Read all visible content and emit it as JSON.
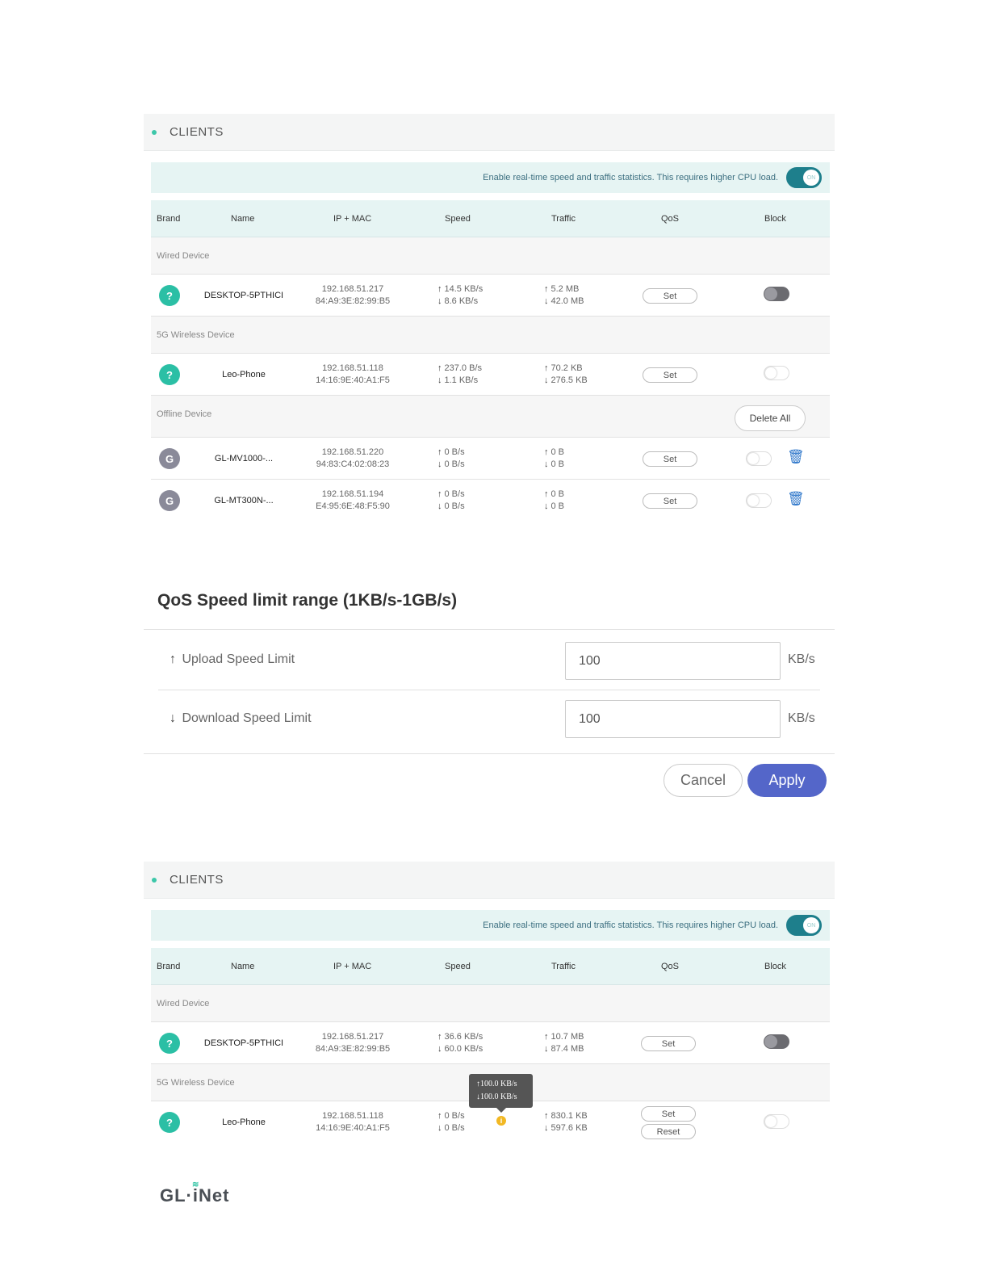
{
  "panel1": {
    "title": "CLIENTS",
    "stats_text": "Enable real-time speed and traffic statistics. This requires higher CPU load.",
    "toggle_label": "ON",
    "columns": [
      "Brand",
      "Name",
      "IP + MAC",
      "Speed",
      "Traffic",
      "QoS",
      "Block"
    ],
    "groups": {
      "wired": "Wired Device",
      "wireless": "5G Wireless Device",
      "offline": "Offline Device"
    },
    "delete_all": "Delete All",
    "rows": [
      {
        "brand": "?",
        "name": "DESKTOP-5PTHICI",
        "ip": "192.168.51.217",
        "mac": "84:A9:3E:82:99:B5",
        "up": "14.5 KB/s",
        "down": "8.6 KB/s",
        "tup": "5.2 MB",
        "tdown": "42.0 MB",
        "qos": "Set",
        "blocked": true
      },
      {
        "brand": "?",
        "name": "Leo-Phone",
        "ip": "192.168.51.118",
        "mac": "14:16:9E:40:A1:F5",
        "up": "237.0 B/s",
        "down": "1.1 KB/s",
        "tup": "70.2 KB",
        "tdown": "276.5 KB",
        "qos": "Set",
        "blocked": false
      },
      {
        "brand": "G",
        "name": "GL-MV1000-...",
        "ip": "192.168.51.220",
        "mac": "94:83:C4:02:08:23",
        "up": "0 B/s",
        "down": "0 B/s",
        "tup": "0 B",
        "tdown": "0 B",
        "qos": "Set",
        "blocked": false
      },
      {
        "brand": "G",
        "name": "GL-MT300N-...",
        "ip": "192.168.51.194",
        "mac": "E4:95:6E:48:F5:90",
        "up": "0 B/s",
        "down": "0 B/s",
        "tup": "0 B",
        "tdown": "0 B",
        "qos": "Set",
        "blocked": false
      }
    ]
  },
  "modal": {
    "title": "QoS Speed limit range (1KB/s-1GB/s)",
    "upload_label": "Upload Speed Limit",
    "upload_value": "100",
    "download_label": "Download Speed Limit",
    "download_value": "100",
    "unit": "KB/s",
    "cancel": "Cancel",
    "apply": "Apply"
  },
  "panel2": {
    "title": "CLIENTS",
    "stats_text": "Enable real-time speed and traffic statistics. This requires higher CPU load.",
    "toggle_label": "ON",
    "columns": [
      "Brand",
      "Name",
      "IP + MAC",
      "Speed",
      "Traffic",
      "QoS",
      "Block"
    ],
    "groups": {
      "wired": "Wired Device",
      "wireless": "5G Wireless Device"
    },
    "rows": [
      {
        "brand": "?",
        "name": "DESKTOP-5PTHICI",
        "ip": "192.168.51.217",
        "mac": "84:A9:3E:82:99:B5",
        "up": "36.6 KB/s",
        "down": "60.0 KB/s",
        "tup": "10.7 MB",
        "tdown": "87.4 MB",
        "qos": "Set",
        "blocked": true
      },
      {
        "brand": "?",
        "name": "Leo-Phone",
        "ip": "192.168.51.118",
        "mac": "14:16:9E:40:A1:F5",
        "up": "0 B/s",
        "down": "0 B/s",
        "tup": "830.1 KB",
        "tdown": "597.6 KB",
        "qos": "Set",
        "reset": "Reset",
        "blocked": false
      }
    ],
    "tooltip": {
      "up": "100.0 KB/s",
      "down": "100.0 KB/s"
    }
  },
  "logo": "GL·iNet",
  "icons": {
    "upload": "arrow-up-icon",
    "download": "arrow-down-icon",
    "delete": "trash-icon",
    "info": "info-icon"
  },
  "colors": {
    "accent": "#1e7f8c",
    "brand_q": "#2bbfa5",
    "apply": "#5466c9"
  }
}
